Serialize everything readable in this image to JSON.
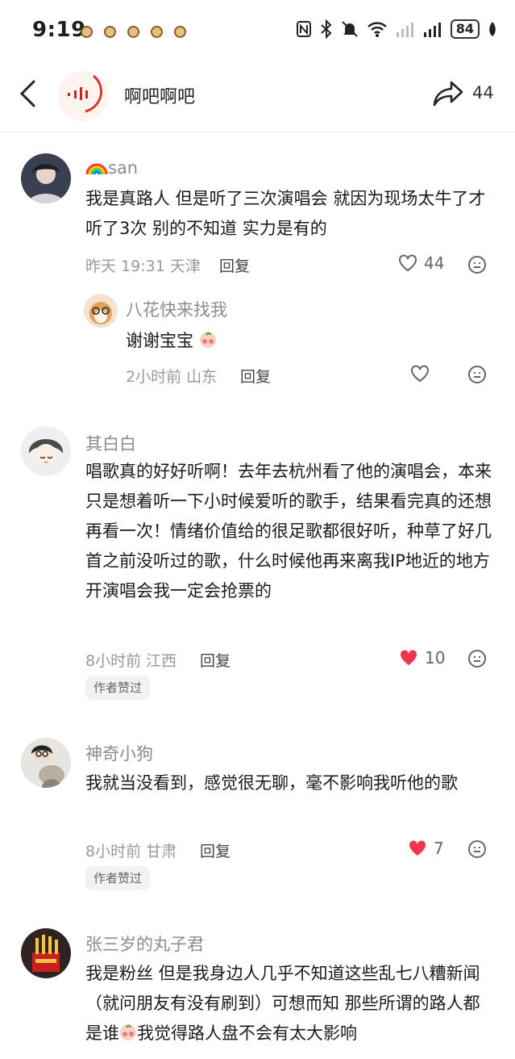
{
  "status_bar": {
    "time": "9:19",
    "battery": "84"
  },
  "header": {
    "title": "啊吧啊吧",
    "share_count": "44"
  },
  "comments": [
    {
      "username": "san",
      "text": "我是真路人 但是听了三次演唱会 就因为现场太牛了才听了3次 别的不知道 实力是有的",
      "time": "昨天 19:31",
      "location": "天津",
      "reply_label": "回复",
      "likes": "44",
      "reply": {
        "username": "八花快来找我",
        "text": "谢谢宝宝",
        "time": "2小时前",
        "location": "山东",
        "reply_label": "回复"
      }
    },
    {
      "username": "其白白",
      "text": "唱歌真的好好听啊！去年去杭州看了他的演唱会，本来只是想着听一下小时候爱听的歌手，结果看完真的还想再看一次！情绪价值给的很足歌都很好听，种草了好几首之前没听过的歌，什么时候他再来离我IP地近的地方开演唱会我一定会抢票的",
      "time": "8小时前",
      "location": "江西",
      "reply_label": "回复",
      "likes": "10",
      "badge": "作者赞过"
    },
    {
      "username": "神奇小狗",
      "text": "我就当没看到，感觉很无聊，毫不影响我听他的歌",
      "time": "8小时前",
      "location": "甘肃",
      "reply_label": "回复",
      "likes": "7",
      "badge": "作者赞过"
    },
    {
      "username": "张三岁的丸子君",
      "text_before": "我是粉丝 但是我身边人几乎不知道这些乱七八糟新闻（就问朋友有没有刷到）可想而知 那些所谓的路人都是谁",
      "text_after": "我觉得路人盘不会有太大影响"
    }
  ],
  "colors": {
    "liked": "#f0364a",
    "muted_text": "#999999",
    "badge_bg": "#f2f2f2"
  }
}
